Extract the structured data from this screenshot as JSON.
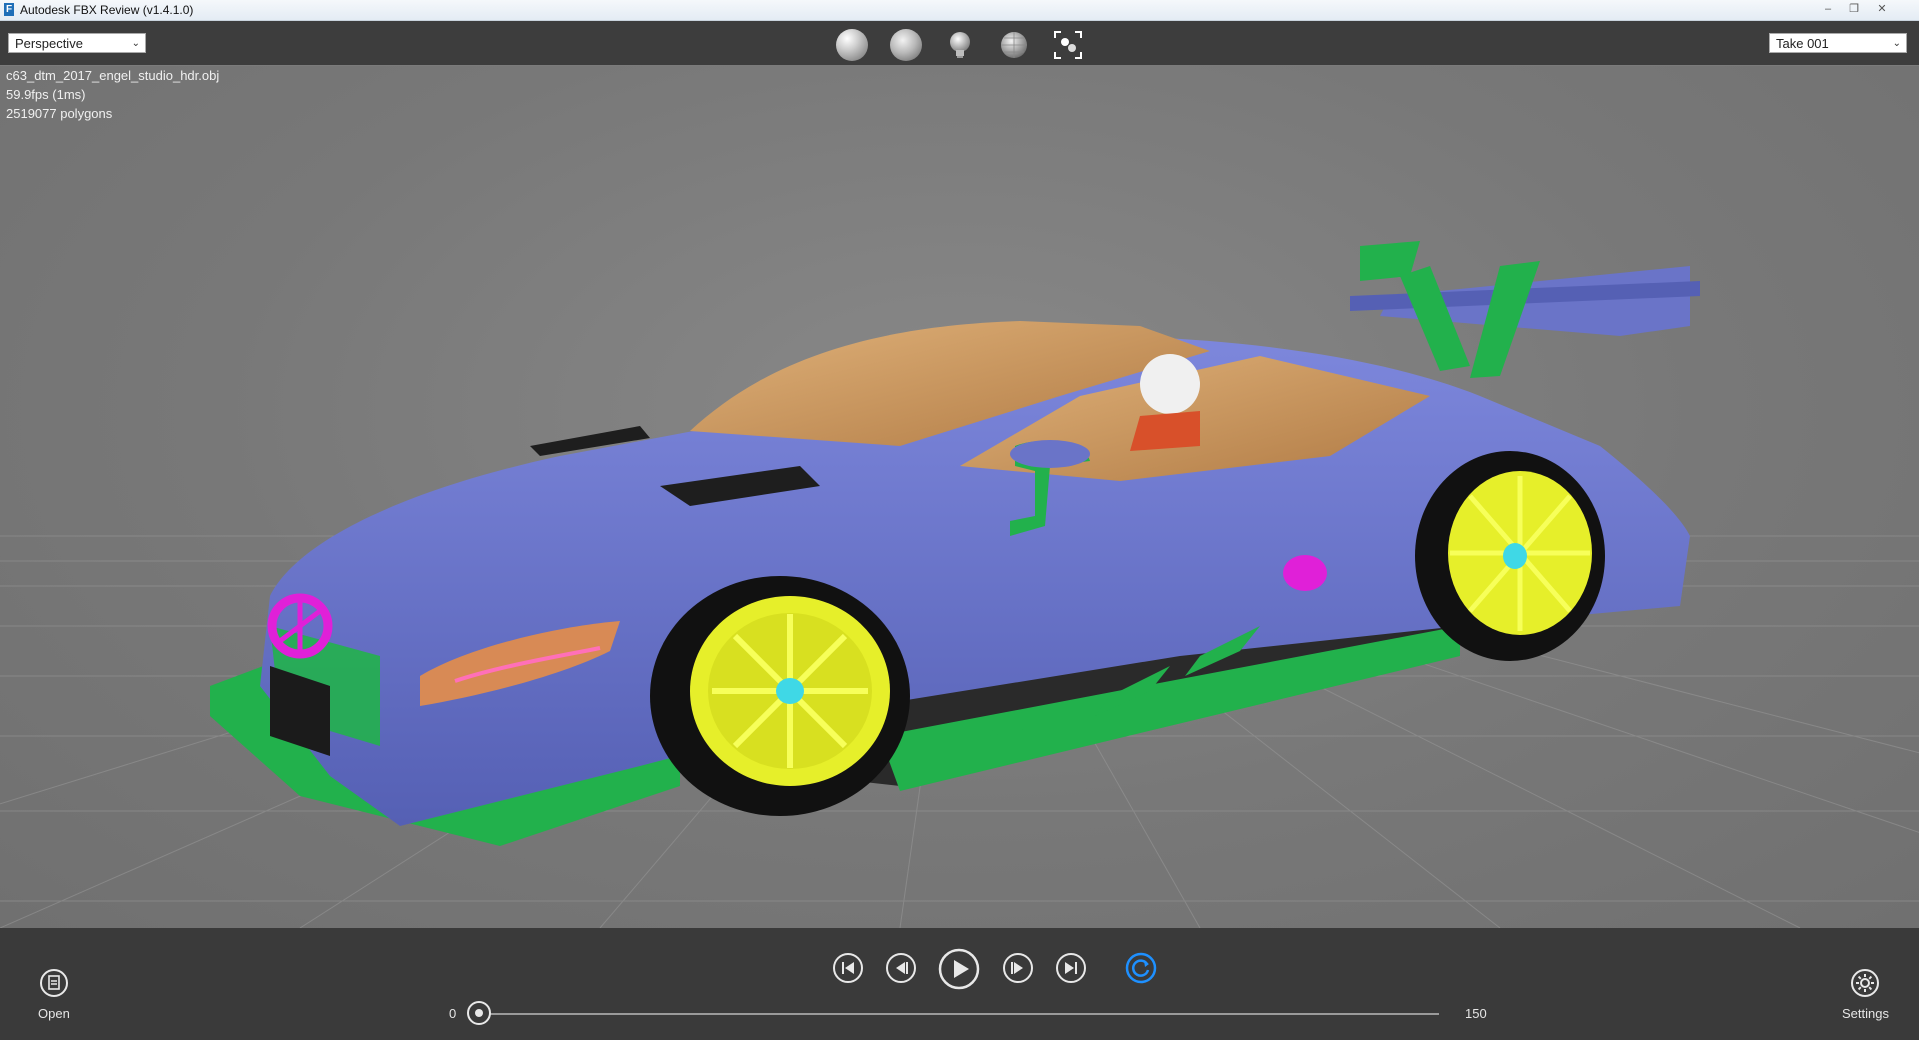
{
  "window": {
    "title": "Autodesk FBX Review (v1.4.1.0)",
    "app_icon": "F"
  },
  "toolbar": {
    "camera_select": {
      "value": "Perspective"
    },
    "take_select": {
      "value": "Take 001"
    },
    "tools": [
      {
        "name": "shading-sphere-icon"
      },
      {
        "name": "smooth-sphere-icon"
      },
      {
        "name": "light-bulb-icon"
      },
      {
        "name": "wireframe-sphere-icon"
      },
      {
        "name": "frame-all-icon"
      }
    ]
  },
  "info": {
    "filename": "c63_dtm_2017_engel_studio_hdr.obj",
    "fps": "59.9fps (1ms)",
    "polygons": "2519077 polygons"
  },
  "playback": {
    "open_label": "Open",
    "settings_label": "Settings",
    "start_frame": "0",
    "end_frame": "150",
    "current_frame_fraction": 0.0
  },
  "colors": {
    "toolbar_bg": "#3d3d3d",
    "viewport_bg": "#7b7b7b",
    "car_body": "#6a74c8",
    "accent_green": "#22b14c",
    "wheel_yellow": "#e6ef2a",
    "accent_magenta": "#e020d8",
    "loop_active": "#1e90ff"
  }
}
